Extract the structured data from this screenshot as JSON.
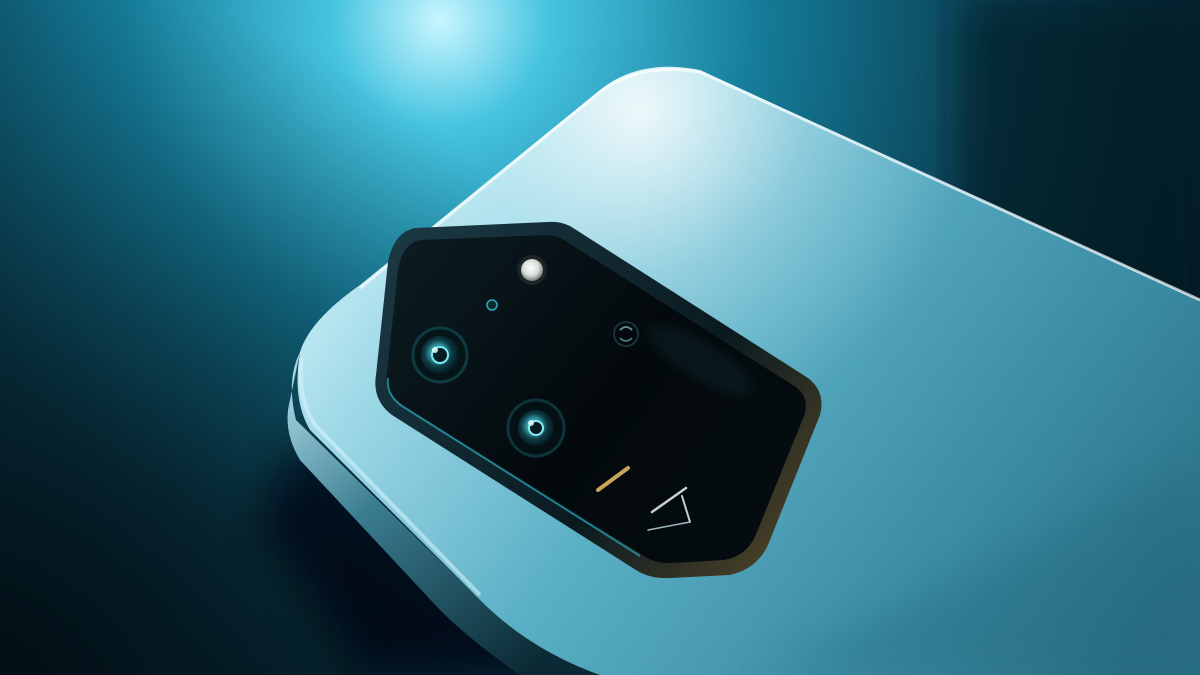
{
  "scene": {
    "subject": "smartphone-rear-camera-module",
    "colors": {
      "background_dark": "#04121a",
      "background_lit": "#1d8fb0",
      "light_glow": "#bff4ff",
      "phone_body": "#5fb7cc",
      "phone_edge": "#0d2e3a",
      "camera_glass": "#02080b",
      "lens_accent": "#3fd2e6",
      "flash": "#e8ecea"
    }
  }
}
